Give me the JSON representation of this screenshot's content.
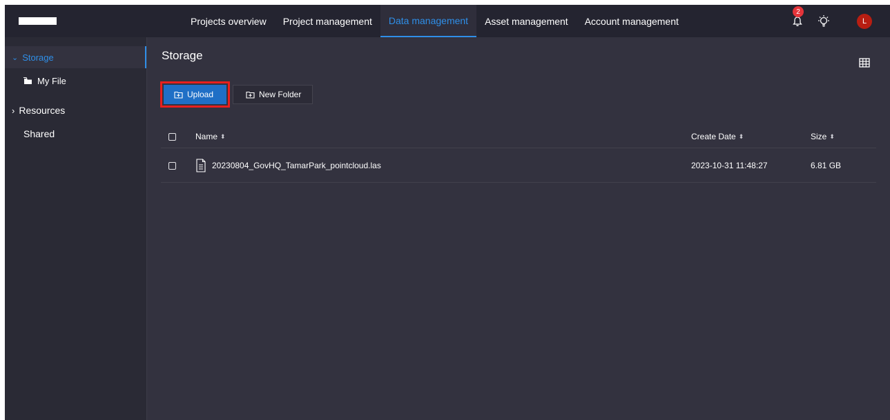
{
  "nav": {
    "tabs": [
      {
        "label": "Projects overview"
      },
      {
        "label": "Project management"
      },
      {
        "label": "Data management",
        "active": true
      },
      {
        "label": "Asset management"
      },
      {
        "label": "Account management"
      }
    ],
    "notification_count": "2",
    "avatar_initial": "L"
  },
  "sidebar": {
    "storage": "Storage",
    "my_file": "My File",
    "resources": "Resources",
    "shared": "Shared"
  },
  "main": {
    "title": "Storage",
    "upload_label": "Upload",
    "new_folder_label": "New Folder",
    "table": {
      "headers": {
        "name": "Name",
        "create_date": "Create Date",
        "size": "Size"
      },
      "rows": [
        {
          "name": "20230804_GovHQ_TamarPark_pointcloud.las",
          "create_date": "2023-10-31 11:48:27",
          "size": "6.81 GB"
        }
      ]
    }
  },
  "colors": {
    "accent": "#2f8fe8",
    "highlight": "#e8201e",
    "badge": "#e5343a",
    "avatar": "#b81e12"
  }
}
